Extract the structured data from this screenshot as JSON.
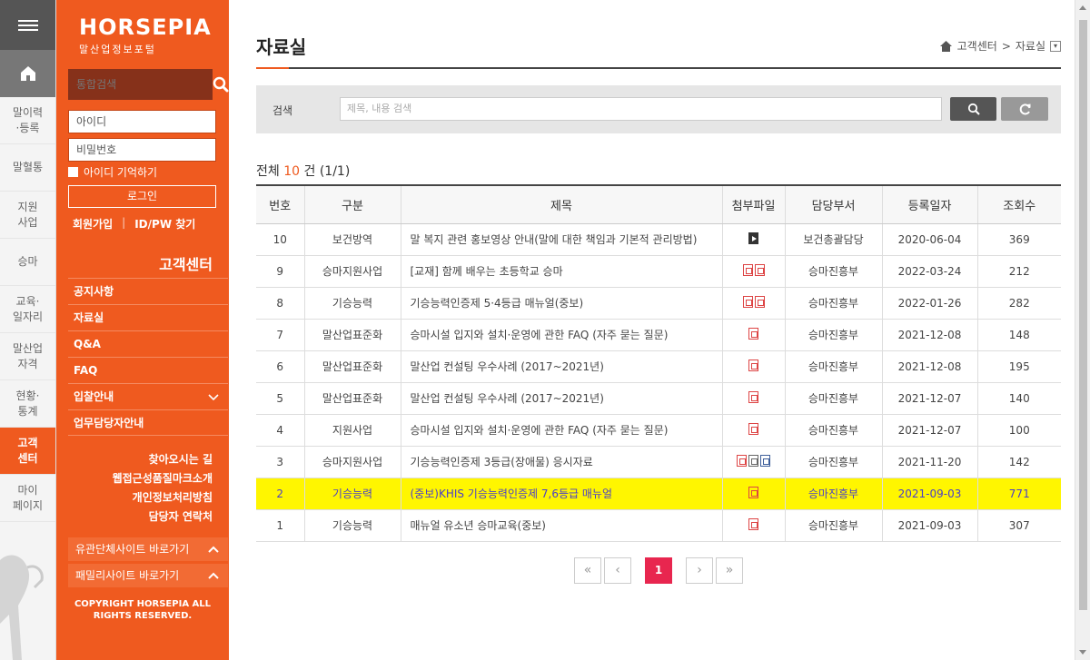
{
  "rail": {
    "items": [
      {
        "label": "말이력\n·등록"
      },
      {
        "label": "말혈통"
      },
      {
        "label": "지원\n사업"
      },
      {
        "label": "승마"
      },
      {
        "label": "교육·\n일자리"
      },
      {
        "label": "말산업\n자격"
      },
      {
        "label": "현황·\n통계"
      },
      {
        "label": "고객\n센터"
      },
      {
        "label": "마이\n페이지"
      }
    ]
  },
  "panel": {
    "logo_main": "HORSEPIA",
    "logo_sub": "말산업정보포털",
    "search_placeholder": "통합검색",
    "id_placeholder": "아이디",
    "pw_placeholder": "비밀번호",
    "remember_label": "아이디 기억하기",
    "login_label": "로그인",
    "join_label": "회원가입",
    "find_label": "ID/PW 찾기",
    "section_title": "고객센터",
    "submenu": [
      {
        "label": "공지사항"
      },
      {
        "label": "자료실"
      },
      {
        "label": "Q&A"
      },
      {
        "label": "FAQ"
      },
      {
        "label": "입찰안내"
      },
      {
        "label": "업무담당자안내"
      }
    ],
    "extra_links": [
      "찾아오시는 길",
      "웹접근성품질마크소개",
      "개인정보처리방침",
      "담당자 연락처"
    ],
    "fold1": "유관단체사이트 바로가기",
    "fold2": "패밀리사이트 바로가기",
    "copyright": "COPYRIGHT HORSEPIA ALL\nRIGHTS RESERVED."
  },
  "main": {
    "title": "자료실",
    "breadcrumb": {
      "current": "고객센터",
      "sep": ">",
      "page": "자료실"
    },
    "search": {
      "label": "검색",
      "placeholder": "제목, 내용 검색"
    },
    "total": {
      "prefix": "전체",
      "count": "10",
      "suffix": "건 (1/1)"
    },
    "columns": [
      "번호",
      "구분",
      "제목",
      "첨부파일",
      "담당부서",
      "등록일자",
      "조회수"
    ],
    "rows": [
      {
        "no": "10",
        "cat": "보건방역",
        "title": "말 복지 관련 홍보영상 안내(말에 대한 책임과 기본적 관리방법)",
        "files": [
          "video"
        ],
        "dept": "보건총괄담당",
        "date": "2020-06-04",
        "views": "369"
      },
      {
        "no": "9",
        "cat": "승마지원사업",
        "title": "[교재] 함께 배우는 초등학교 승마",
        "files": [
          "pdf",
          "pdf"
        ],
        "dept": "승마진흥부",
        "date": "2022-03-24",
        "views": "212"
      },
      {
        "no": "8",
        "cat": "기승능력",
        "title": "기승능력인증제 5·4등급 매뉴얼(중보)",
        "files": [
          "pdf",
          "pdf"
        ],
        "dept": "승마진흥부",
        "date": "2022-01-26",
        "views": "282"
      },
      {
        "no": "7",
        "cat": "말산업표준화",
        "title": "승마시설 입지와 설치·운영에 관한 FAQ (자주 묻는 질문)",
        "files": [
          "pdf"
        ],
        "dept": "승마진흥부",
        "date": "2021-12-08",
        "views": "148"
      },
      {
        "no": "6",
        "cat": "말산업표준화",
        "title": "말산업 컨설팅 우수사례 (2017~2021년)",
        "files": [
          "pdf"
        ],
        "dept": "승마진흥부",
        "date": "2021-12-08",
        "views": "195"
      },
      {
        "no": "5",
        "cat": "말산업표준화",
        "title": "말산업 컨설팅 우수사례 (2017~2021년)",
        "files": [
          "pdf"
        ],
        "dept": "승마진흥부",
        "date": "2021-12-07",
        "views": "140"
      },
      {
        "no": "4",
        "cat": "지원사업",
        "title": "승마시설 입지와 설치·운영에 관한 FAQ (자주 묻는 질문)",
        "files": [
          "pdf"
        ],
        "dept": "승마진흥부",
        "date": "2021-12-07",
        "views": "100"
      },
      {
        "no": "3",
        "cat": "승마지원사업",
        "title": "기승능력인증제 3등급(장애물) 응시자료",
        "files": [
          "pdf",
          "doc",
          "hwp"
        ],
        "dept": "승마진흥부",
        "date": "2021-11-20",
        "views": "142"
      },
      {
        "no": "2",
        "cat": "기승능력",
        "title": "(중보)KHIS 기승능력인증제 7,6등급 매뉴얼",
        "files": [
          "pdf"
        ],
        "dept": "승마진흥부",
        "date": "2021-09-03",
        "views": "771",
        "highlight": true
      },
      {
        "no": "1",
        "cat": "기승능력",
        "title": "매뉴얼 유소년 승마교육(중보)",
        "files": [
          "pdf"
        ],
        "dept": "승마진흥부",
        "date": "2021-09-03",
        "views": "307"
      }
    ],
    "pager": {
      "first": "«",
      "prev": "‹",
      "current": "1",
      "next": "›",
      "last": "»"
    }
  },
  "colors": {
    "brand": "#ef5a1f",
    "highlight": "#fff600",
    "page_active": "#e8264f"
  }
}
